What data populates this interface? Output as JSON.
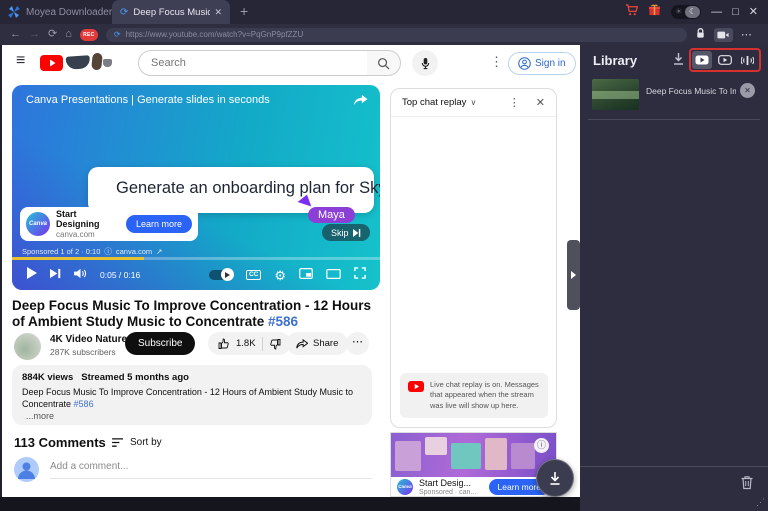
{
  "titlebar": {
    "app_name": "Moyea Downloader",
    "tab_title": "Deep Focus Music To",
    "tab_close": "✕",
    "new_tab": "+",
    "minimize": "—",
    "maximize": "□",
    "close": "✕",
    "sun": "☀",
    "moon": "☾"
  },
  "navbar": {
    "back": "←",
    "forward": "→",
    "reload": "⟳",
    "home": "⌂",
    "rec": "REC",
    "spinner": "⟳",
    "url": "https://www.youtube.com/watch?v=PqGnP9pfZZU",
    "menu": "⋯"
  },
  "yt_header": {
    "menu": "≡",
    "search_placeholder": "Search",
    "kebab": "⋮",
    "sign_in": "Sign in"
  },
  "player": {
    "ad_headline": "Canva Presentations | Generate slides in seconds",
    "slide_text": "Generate an onboarding plan for Skye",
    "cursor_name": "Maya",
    "brand": "Canva",
    "ad_title": "Start Designing",
    "ad_domain": "canva.com",
    "learn_more": "Learn more",
    "skip": "Skip",
    "sponsored": "Sponsored 1 of 2 · 0:10",
    "info_icon": "ⓘ",
    "sponsored_domain": "canva.com",
    "external_icon": "↗",
    "time": "0:05 / 0:16",
    "cc": "CC",
    "gear": "⚙",
    "progress_pct": 36
  },
  "video": {
    "title": "Deep Focus Music To Improve Concentration - 12 Hours of Ambient Study Music to Concentrate",
    "title_tag": "#586",
    "channel": "4K Video Nature - ✧",
    "subscribers": "287K subscribers",
    "subscribe": "Subscribe",
    "likes": "1.8K",
    "share": "Share",
    "more_menu": "⋯",
    "views": "884K views",
    "streamed": "Streamed 5 months ago",
    "description": "Deep Focus Music To Improve Concentration - 12 Hours of Ambient Study Music to Concentrate",
    "desc_tag": "#586",
    "more": "...more"
  },
  "comments": {
    "count": "113 Comments",
    "sort": "Sort by",
    "placeholder": "Add a comment..."
  },
  "chat": {
    "header": "Top chat replay",
    "chevron": "∨",
    "kebab": "⋮",
    "close": "✕",
    "notice": "Live chat replay is on. Messages that appeared when the stream was live will show up here."
  },
  "ad_card": {
    "info": "ⓘ",
    "title": "Start Desig...",
    "sponsored": "Sponsored · can...",
    "cta": "Learn more"
  },
  "library": {
    "title": "Library",
    "item_title": "Deep Focus Music To Im...",
    "item_close": "✕",
    "grip": "⋰"
  },
  "colors": {
    "accent_red": "#d63031",
    "link_blue": "#3d6fd0",
    "canva_blue": "#2a63f5",
    "panel_bg": "#2d2d3f",
    "progress_yellow": "#e6c230"
  }
}
